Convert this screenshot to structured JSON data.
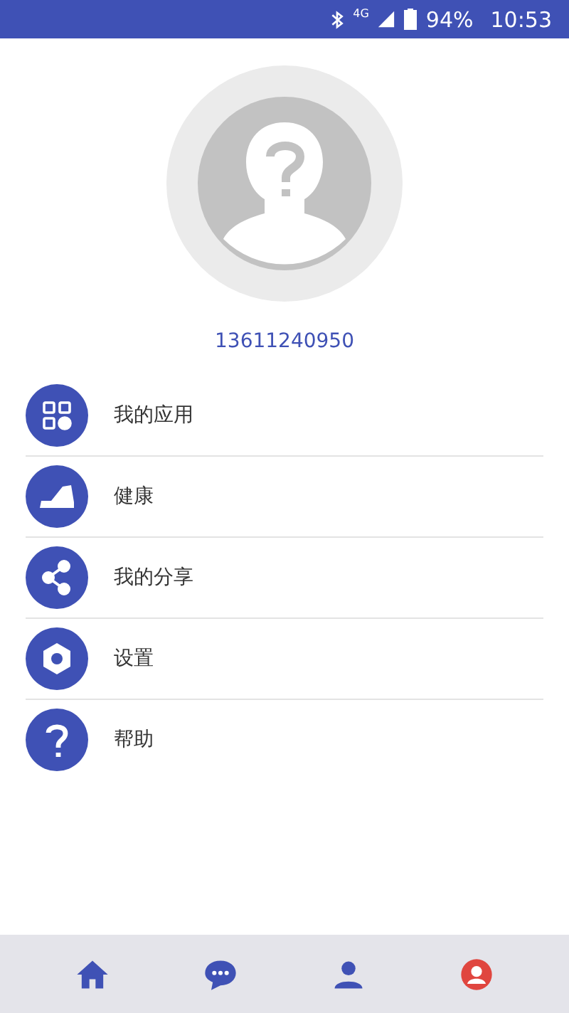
{
  "status_bar": {
    "network": "4G",
    "battery": "94%",
    "time": "10:53"
  },
  "profile": {
    "phone": "13611240950"
  },
  "menu": [
    {
      "kind": "apps",
      "label": "我的应用"
    },
    {
      "kind": "health",
      "label": "健康"
    },
    {
      "kind": "share",
      "label": "我的分享"
    },
    {
      "kind": "settings",
      "label": "设置"
    },
    {
      "kind": "help",
      "label": "帮助"
    }
  ],
  "bottom_nav": [
    {
      "kind": "home",
      "selected": false
    },
    {
      "kind": "chat",
      "selected": false
    },
    {
      "kind": "person",
      "selected": false
    },
    {
      "kind": "me",
      "selected": true
    }
  ]
}
